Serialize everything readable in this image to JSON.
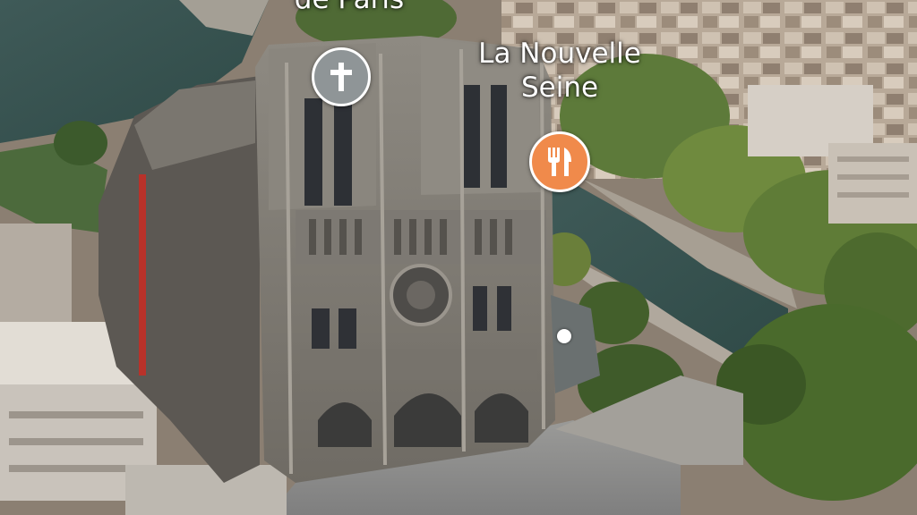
{
  "labels": {
    "top_cut": "de Paris",
    "restaurant_line1": "La Nouvelle",
    "restaurant_line2": "Seine"
  },
  "pins": {
    "church": {
      "icon": "cross-icon",
      "color": "#8f9597"
    },
    "restaurant": {
      "icon": "fork-knife-icon",
      "color": "#f08a4b"
    },
    "location": {
      "icon": "location-dot-icon",
      "color": "#ffffff"
    }
  }
}
